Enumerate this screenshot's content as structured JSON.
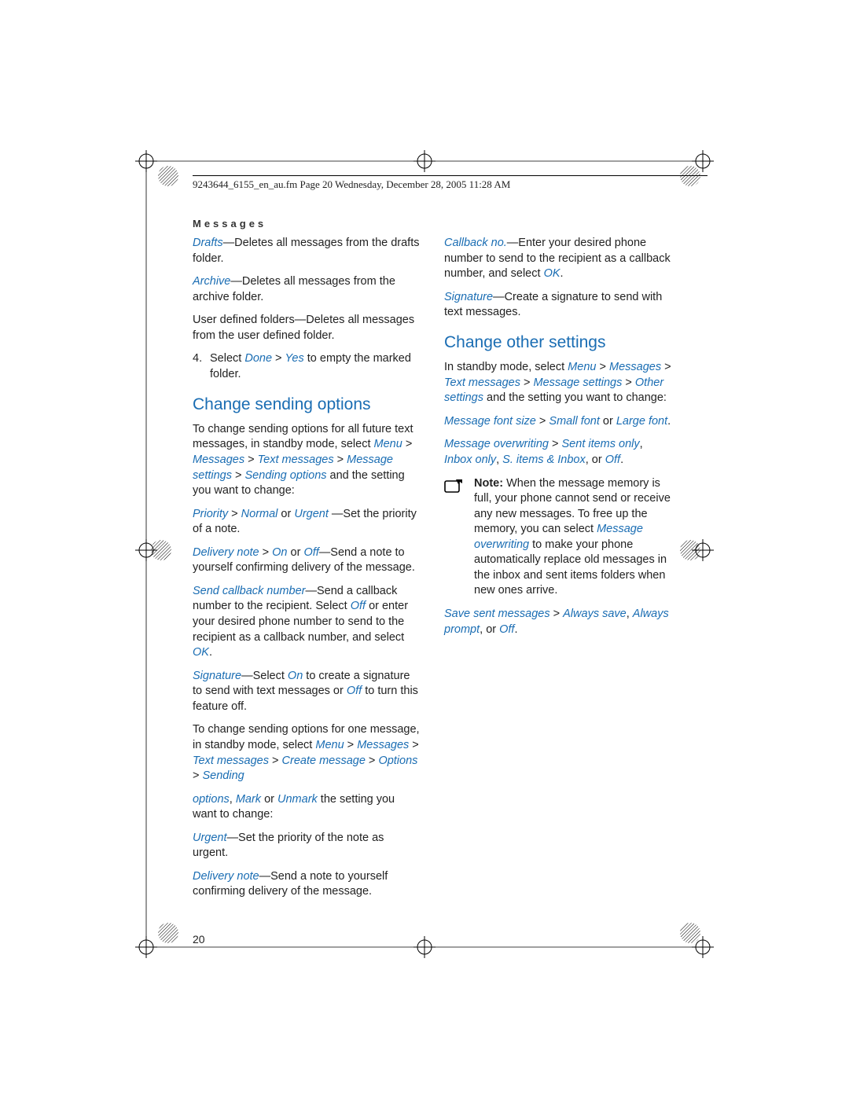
{
  "header": "9243644_6155_en_au.fm  Page 20  Wednesday, December 28, 2005  11:28 AM",
  "section_header": "Messages",
  "page_number": "20",
  "col1": {
    "p1a": "Drafts",
    "p1b": "—Deletes all messages from the drafts folder.",
    "p2a": "Archive",
    "p2b": "—Deletes all messages from the archive folder.",
    "p3": "User defined folders—Deletes all messages from the user defined folder.",
    "p4_num": "4.",
    "p4a": "Select ",
    "p4b": "Done",
    "p4c": " > ",
    "p4d": "Yes",
    "p4e": " to empty the marked folder.",
    "h1": "Change sending options",
    "p5a": "To change sending options for all future text messages, in standby mode, select ",
    "p5b": "Menu",
    "p5c": " > ",
    "p5d": "Messages",
    "p5e": " > ",
    "p5f": "Text messages",
    "p5g": " > ",
    "p5h": "Message settings",
    "p5i": " > ",
    "p5j": "Sending options",
    "p5k": " and the setting you want to change:",
    "p6a": "Priority",
    "p6b": " > ",
    "p6c": "Normal",
    "p6d": " or ",
    "p6e": "Urgent",
    "p6f": " —Set the priority of a note.",
    "p7a": "Delivery note",
    "p7b": " > ",
    "p7c": "On",
    "p7d": " or ",
    "p7e": "Off",
    "p7f": "—Send a note to yourself confirming delivery of the message.",
    "p8a": "Send callback number",
    "p8b": "—Send a callback number to the recipient. Select ",
    "p8c": "Off",
    "p8d": " or enter your desired phone number to send to the recipient as a callback number, and select ",
    "p8e": "OK",
    "p8f": ".",
    "p9a": "Signature",
    "p9b": "—Select ",
    "p9c": "On",
    "p9d": " to create a signature to send with text messages or ",
    "p9e": "Off",
    "p9f": " to turn this feature off.",
    "p10a": "To change sending options for one message, in standby mode, select ",
    "p10b": "Menu",
    "p10c": " > ",
    "p10d": "Messages",
    "p10e": " > ",
    "p10f": "Text messages",
    "p10g": " > ",
    "p10h": "Create message",
    "p10i": " > ",
    "p10j": "Options",
    "p10k": " > ",
    "p10l": "Sending"
  },
  "col2": {
    "p1a": "options",
    "p1b": ", ",
    "p1c": "Mark",
    "p1d": " or ",
    "p1e": "Unmark",
    "p1f": " the setting you want to change:",
    "p2a": "Urgent",
    "p2b": "—Set the priority of the note as urgent.",
    "p3a": "Delivery note",
    "p3b": "—Send a note to yourself confirming delivery of the message.",
    "p4a": "Callback no.",
    "p4b": "—Enter your desired phone number to send to the recipient as a callback number, and select ",
    "p4c": "OK",
    "p4d": ".",
    "p5a": "Signature",
    "p5b": "—Create a signature to send with text messages.",
    "h2": "Change other settings",
    "p6a": "In standby mode, select ",
    "p6b": "Menu",
    "p6c": " > ",
    "p6d": "Messages",
    "p6e": " > ",
    "p6f": "Text messages",
    "p6g": " > ",
    "p6h": "Message settings",
    "p6i": " > ",
    "p6j": "Other settings",
    "p6k": " and the setting you want to change:",
    "p7a": "Message font size",
    "p7b": " > ",
    "p7c": "Small font",
    "p7d": " or ",
    "p7e": "Large font",
    "p7f": ".",
    "p8a": "Message overwriting",
    "p8b": " > ",
    "p8c": "Sent items only",
    "p8d": ", ",
    "p8e": "Inbox only",
    "p8f": ", ",
    "p8g": "S. items & Inbox",
    "p8h": ", or ",
    "p8i": "Off",
    "p8j": ".",
    "note_bold": "Note: ",
    "note_a": "When the message memory is full, your phone cannot send or receive any new messages. To free up the memory, you can select ",
    "note_b": "Message overwriting",
    "note_c": " to make your phone automatically replace old messages in the inbox and sent items folders when new ones arrive.",
    "p9a": "Save sent messages",
    "p9b": " > ",
    "p9c": "Always save",
    "p9d": ", ",
    "p9e": "Always prompt",
    "p9f": ", or ",
    "p9g": "Off",
    "p9h": "."
  }
}
